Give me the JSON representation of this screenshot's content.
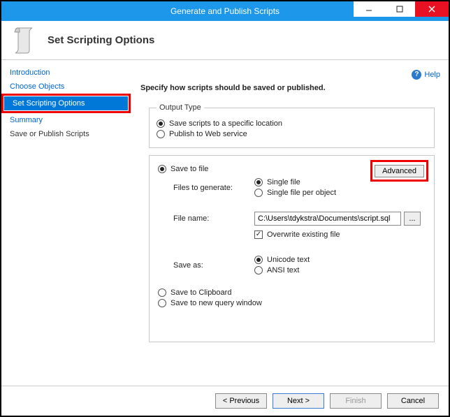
{
  "window": {
    "title": "Generate and Publish Scripts"
  },
  "header": {
    "title": "Set Scripting Options"
  },
  "help": {
    "label": "Help"
  },
  "sidebar": {
    "items": [
      {
        "label": "Introduction"
      },
      {
        "label": "Choose Objects"
      },
      {
        "label": "Set Scripting Options"
      },
      {
        "label": "Summary"
      },
      {
        "label": "Save or Publish Scripts"
      }
    ]
  },
  "content": {
    "instruction": "Specify how scripts should be saved or published.",
    "output_type": {
      "legend": "Output Type",
      "save_location": "Save scripts to a specific location",
      "publish_web": "Publish to Web service"
    },
    "panel": {
      "advanced": "Advanced",
      "save_to_file": "Save to file",
      "files_to_generate_label": "Files to generate:",
      "single_file": "Single file",
      "single_file_per_object": "Single file per object",
      "file_name_label": "File name:",
      "file_name_value": "C:\\Users\\tdykstra\\Documents\\script.sql",
      "overwrite": "Overwrite existing file",
      "save_as_label": "Save as:",
      "unicode": "Unicode text",
      "ansi": "ANSI text",
      "save_clipboard": "Save to Clipboard",
      "save_new_query": "Save to new query window"
    }
  },
  "footer": {
    "previous": "< Previous",
    "next": "Next >",
    "finish": "Finish",
    "cancel": "Cancel"
  }
}
